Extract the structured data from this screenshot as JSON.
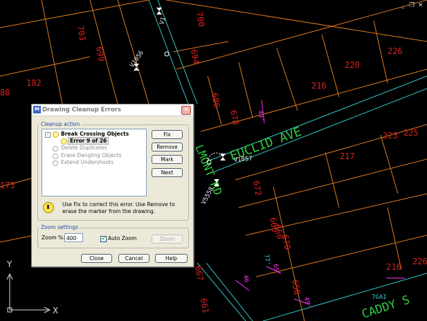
{
  "window_controls": {
    "minimize": "_",
    "restore": "❐",
    "close": "✕"
  },
  "drawing": {
    "parcels": [
      {
        "label": "703"
      },
      {
        "label": "699"
      },
      {
        "label": "700"
      },
      {
        "label": "694"
      },
      {
        "label": "182"
      },
      {
        "label": "80"
      },
      {
        "label": "686"
      },
      {
        "label": "678"
      },
      {
        "label": "173"
      },
      {
        "label": "220"
      },
      {
        "label": "226"
      },
      {
        "label": "216"
      },
      {
        "label": "223"
      },
      {
        "label": "225"
      },
      {
        "label": "217"
      },
      {
        "label": "672"
      },
      {
        "label": "666"
      },
      {
        "label": "660"
      },
      {
        "label": "670"
      },
      {
        "label": "658"
      },
      {
        "label": "216"
      },
      {
        "label": "226"
      },
      {
        "label": "667"
      },
      {
        "label": "661"
      }
    ],
    "streets": [
      {
        "label": "EUCLID AVE"
      },
      {
        "label": "CADDY S"
      },
      {
        "label": "LMONT RD"
      }
    ],
    "nodes": [
      {
        "label": "V1056"
      },
      {
        "label": "V1057"
      },
      {
        "label": "V5558"
      },
      {
        "label": "V1"
      }
    ],
    "dims": [
      {
        "label": "49'"
      },
      {
        "label": "65'"
      },
      {
        "label": "46"
      },
      {
        "label": "49'"
      },
      {
        "label": "7GAI"
      },
      {
        "label": "77'"
      }
    ],
    "colors": {
      "lot_line": "#e07a1e",
      "parcel_text": "#e02020",
      "street_text": "#2ecc40",
      "road_line": "#35c9c9",
      "dim": "#ff33ff"
    }
  },
  "ucs": {
    "y_label": "Y",
    "x_label": "X"
  },
  "dialog": {
    "title": "Drawing Cleanup Errors",
    "close_icon": "close-icon",
    "cleanup_action": {
      "group_label": "Cleanup action",
      "tree": [
        {
          "label": "Break Crossing Objects",
          "state": "active",
          "expander": "-"
        },
        {
          "label": "Error 9 of 26",
          "state": "selected"
        },
        {
          "label": "Delete Duplicates",
          "state": "disabled"
        },
        {
          "label": "Erase Dangling Objects",
          "state": "disabled"
        },
        {
          "label": "Extend Undershoots",
          "state": "disabled"
        }
      ],
      "buttons": {
        "fix": "Fix",
        "remove": "Remove",
        "mark": "Mark",
        "next": "Next"
      },
      "message": "Use Fix to correct this error. Use Remove to erase the  marker from the drawing."
    },
    "zoom_settings": {
      "group_label": "Zoom settings",
      "zoom_label": "Zoom %:",
      "zoom_value": "400",
      "auto_zoom_label": "Auto Zoom",
      "auto_zoom_checked": true,
      "zoom_button": "Zoom"
    },
    "footer": {
      "close": "Close",
      "cancel": "Cancel",
      "help": "Help"
    }
  }
}
